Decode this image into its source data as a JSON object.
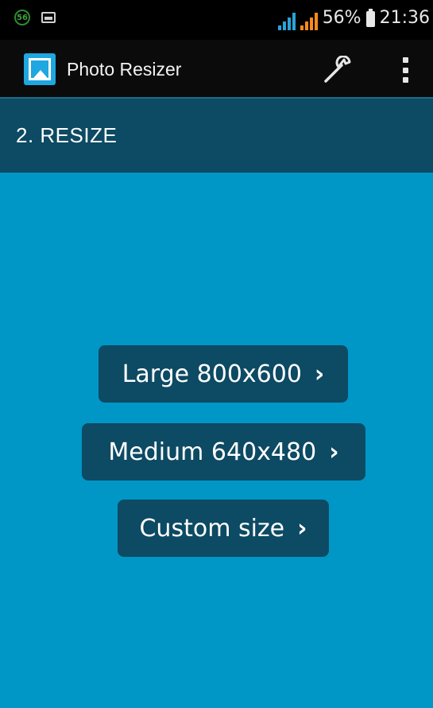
{
  "status_bar": {
    "notification_badge": "56",
    "battery_percent": "56%",
    "time": "21:36",
    "icons": [
      "notification-badge-icon",
      "gallery-notification-icon",
      "data-signal-icon",
      "cell-signal-icon",
      "battery-icon"
    ]
  },
  "action_bar": {
    "app_title": "Photo Resizer",
    "icons": [
      "app-logo-icon",
      "wrench-icon",
      "overflow-menu-icon"
    ]
  },
  "step": {
    "title": "2. RESIZE"
  },
  "options": [
    {
      "label": "Large 800x600",
      "chevron": "›"
    },
    {
      "label": "Medium 640x480",
      "chevron": "›"
    },
    {
      "label": "Custom size",
      "chevron": "›"
    }
  ],
  "colors": {
    "background": "#0096c6",
    "header": "#0d4a63",
    "button": "#0d4a63",
    "status_bar": "#000000",
    "action_bar": "#0b0b0b"
  }
}
